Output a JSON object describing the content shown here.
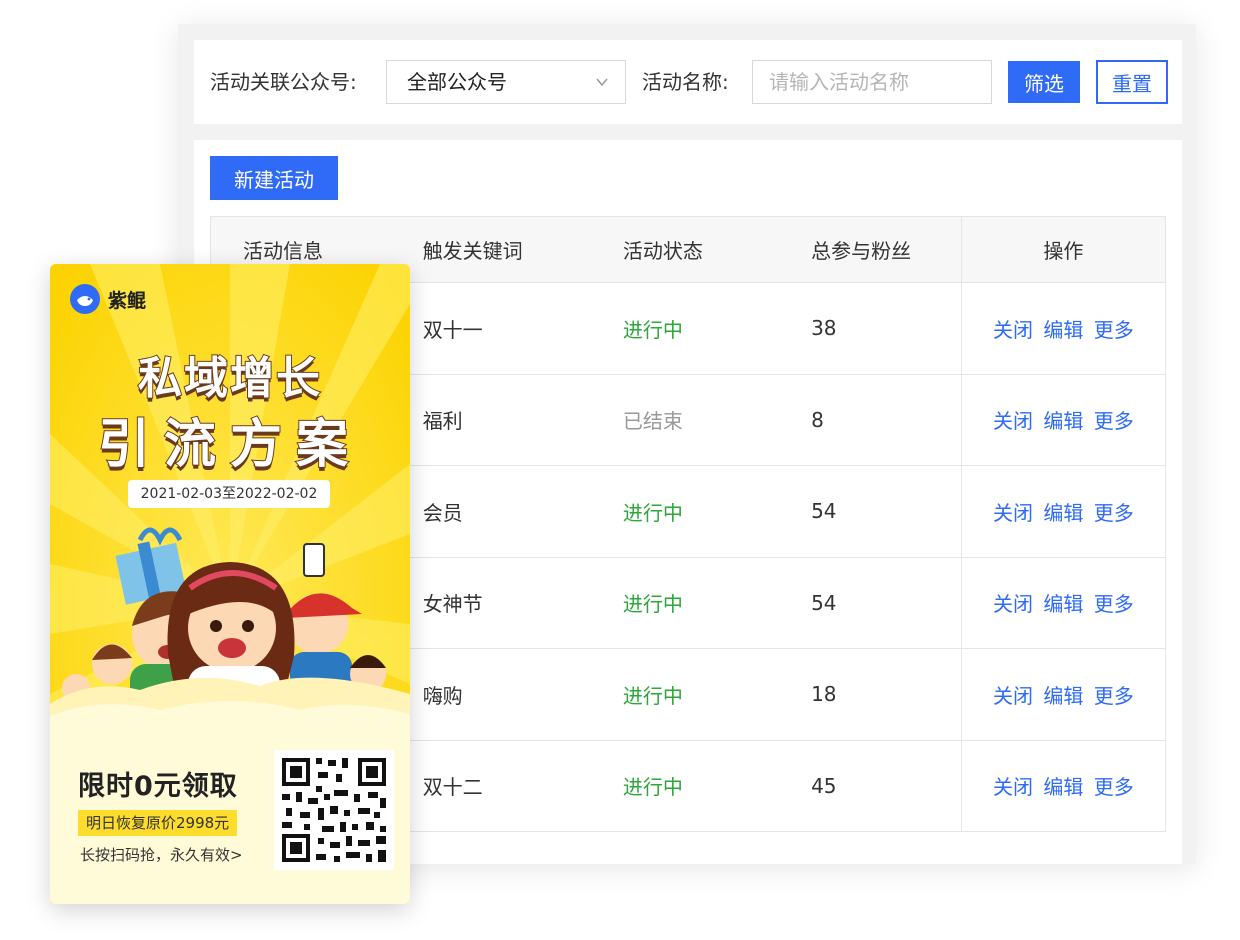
{
  "filter": {
    "account_label": "活动关联公众号:",
    "account_value": "全部公众号",
    "name_label": "活动名称:",
    "name_placeholder": "请输入活动名称",
    "filter_button": "筛选",
    "reset_button": "重置"
  },
  "toolbar": {
    "new_button": "新建活动"
  },
  "table": {
    "headers": [
      "活动信息",
      "触发关键词",
      "活动状态",
      "总参与粉丝",
      "操作"
    ],
    "rows": [
      {
        "keyword": "双十一",
        "status": "进行中",
        "fans": "38"
      },
      {
        "keyword": "福利",
        "status": "已结束",
        "fans": "8"
      },
      {
        "keyword": "会员",
        "status": "进行中",
        "fans": "54"
      },
      {
        "keyword": "女神节",
        "status": "进行中",
        "fans": "54"
      },
      {
        "keyword": "嗨购",
        "status": "进行中",
        "fans": "18"
      },
      {
        "keyword": "双十二",
        "status": "进行中",
        "fans": "45"
      }
    ],
    "actions": {
      "close": "关闭",
      "edit": "编辑",
      "more": "更多"
    }
  },
  "poster": {
    "brand": "紫鲲",
    "headline1": "私域增长",
    "headline2": "引流方案",
    "dates": "2021-02-03至2022-02-02",
    "title": "限时0元领取",
    "tag": "明日恢复原价2998元",
    "note": "长按扫码抢，永久有效>"
  },
  "colors": {
    "primary": "#2f6bf6",
    "status_active": "#2ea63a",
    "status_ended": "#999999",
    "poster_yellow": "#fde32b"
  }
}
